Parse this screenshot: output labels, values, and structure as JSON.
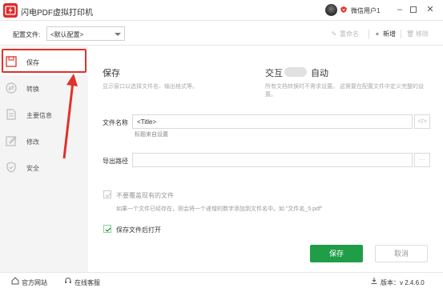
{
  "app": {
    "title": "闪电PDF虚拟打印机",
    "user_name": "微信用户1",
    "colors": {
      "brand": "#e02a2a",
      "accent": "#1f9d47",
      "highlight": "#e0322b"
    }
  },
  "configbar": {
    "label": "配置文件:",
    "selected": "<默认配置>",
    "rename": "重命名",
    "new": "新增",
    "remove": "移除"
  },
  "sidebar": {
    "items": [
      {
        "label": "保存",
        "icon": "save-icon",
        "active": true
      },
      {
        "label": "转换",
        "icon": "convert-icon",
        "active": false
      },
      {
        "label": "主要信息",
        "icon": "info-icon",
        "active": false
      },
      {
        "label": "修改",
        "icon": "edit-icon",
        "active": false
      },
      {
        "label": "安全",
        "icon": "shield-icon",
        "active": false
      }
    ]
  },
  "main": {
    "save_title": "保存",
    "save_desc": "显示窗口以选择文件名、输出格式等。",
    "interact_title": "交互",
    "auto_title": "自动",
    "interact_desc": "所有文档转换时不需求设置。 这需要在配置文件中定义完整的设置。",
    "filename_label": "文件名称",
    "filename_value": "<Title>",
    "filename_hint": "标题来自设置",
    "filename_btn": "</>",
    "path_label": "导出路径",
    "path_value": "",
    "path_btn": "···",
    "no_overwrite_label": "不要覆盖现有的文件",
    "no_overwrite_hint": "如果一个文件已经存在，则会将一个递增的数字添加到文件名中。如 \"文件名_5.pdf\"",
    "open_after_label": "保存文件后打开",
    "save_button": "保存",
    "cancel_button": "取消"
  },
  "statusbar": {
    "website": "官方网站",
    "support": "在线客服",
    "version": "版本：v 2.4.6.0"
  }
}
